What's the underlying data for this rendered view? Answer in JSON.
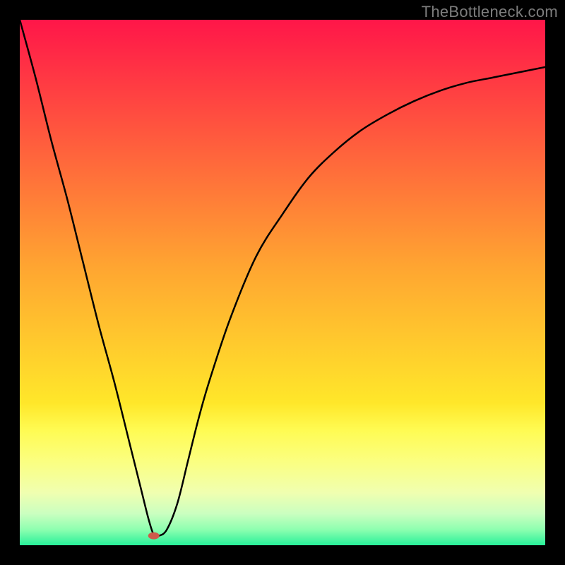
{
  "attribution": "TheBottleneck.com",
  "chart_data": {
    "type": "line",
    "title": "",
    "xlabel": "",
    "ylabel": "",
    "xlim": [
      0,
      100
    ],
    "ylim": [
      0,
      100
    ],
    "grid": false,
    "legend": false,
    "background_gradient": {
      "stops": [
        {
          "pct": 0.0,
          "color": "#ff1649"
        },
        {
          "pct": 0.47,
          "color": "#ffa531"
        },
        {
          "pct": 0.73,
          "color": "#ffe72a"
        },
        {
          "pct": 0.78,
          "color": "#fffb52"
        },
        {
          "pct": 0.84,
          "color": "#fbff80"
        },
        {
          "pct": 0.9,
          "color": "#f0ffb0"
        },
        {
          "pct": 0.94,
          "color": "#caffc0"
        },
        {
          "pct": 0.97,
          "color": "#8effb0"
        },
        {
          "pct": 1.0,
          "color": "#28f09a"
        }
      ]
    },
    "curve": {
      "x": [
        0,
        3,
        6,
        9,
        12,
        15,
        18,
        21,
        23,
        24.5,
        25.5,
        26.5,
        28,
        30,
        32,
        34,
        36,
        40,
        45,
        50,
        55,
        60,
        65,
        70,
        75,
        80,
        85,
        90,
        95,
        100
      ],
      "y": [
        100,
        89,
        77,
        66,
        54,
        42,
        31,
        19,
        11,
        5,
        2,
        1.8,
        3,
        8,
        16,
        24,
        31,
        43,
        55,
        63,
        70,
        75,
        79,
        82,
        84.5,
        86.5,
        88,
        89,
        90,
        91
      ]
    },
    "marker": {
      "x": 25.5,
      "y": 1.8,
      "color": "#cf5b4b",
      "rx": 8,
      "ry": 5
    }
  }
}
